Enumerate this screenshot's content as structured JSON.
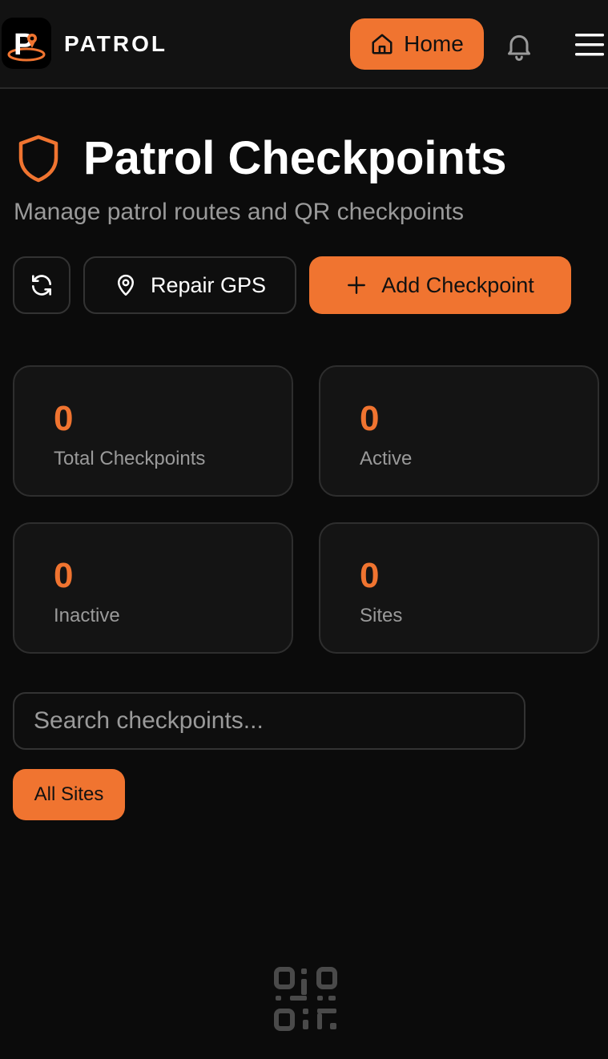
{
  "header": {
    "brand": "PATROL",
    "home_label": "Home",
    "logo_letter": "P",
    "icons": {
      "home": "home-icon",
      "bell": "bell-icon",
      "menu": "menu-icon"
    }
  },
  "main": {
    "title": "Patrol Checkpoints",
    "subtitle": "Manage patrol routes and QR checkpoints",
    "actions": {
      "repair_gps_label": "Repair GPS",
      "add_checkpoint_label": "Add Checkpoint"
    },
    "stats": [
      {
        "value": "0",
        "label": "Total Checkpoints"
      },
      {
        "value": "0",
        "label": "Active"
      },
      {
        "value": "0",
        "label": "Inactive"
      },
      {
        "value": "0",
        "label": "Sites"
      }
    ],
    "search": {
      "placeholder": "Search checkpoints..."
    },
    "filters": {
      "all_sites_label": "All Sites"
    }
  },
  "colors": {
    "accent": "#f07430",
    "background": "#0b0b0b",
    "card": "#141414",
    "muted_text": "#9a9a9a"
  }
}
